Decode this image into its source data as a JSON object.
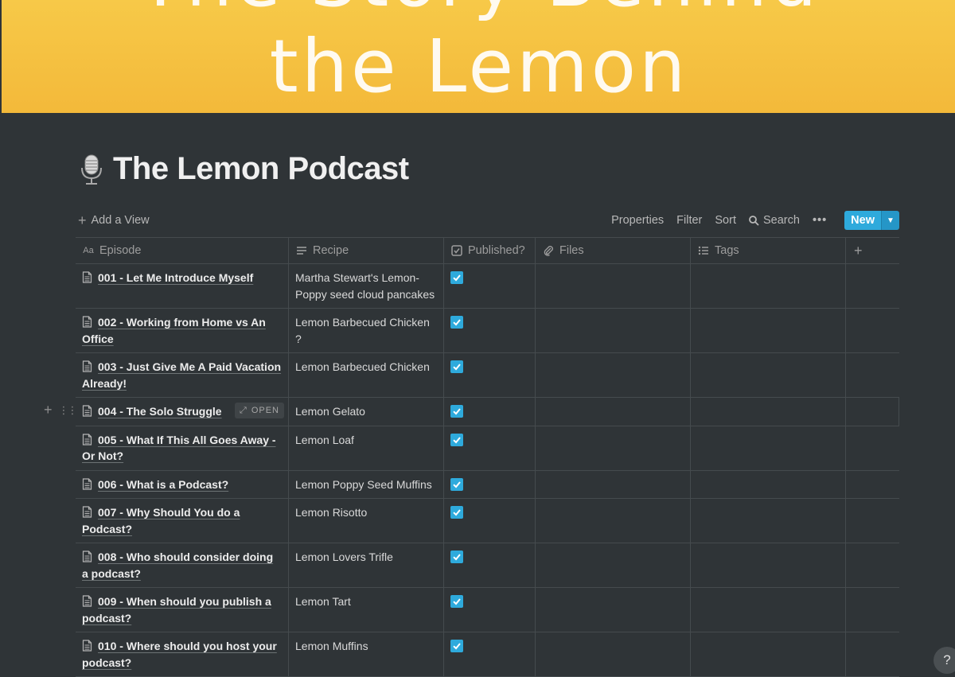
{
  "cover": {
    "title_line1": "The Story Behind",
    "title_line2": "the Lemon"
  },
  "page": {
    "icon": "microphone-icon",
    "title": "The Lemon Podcast"
  },
  "toolbar": {
    "add_view": "Add a View",
    "properties": "Properties",
    "filter": "Filter",
    "sort": "Sort",
    "search": "Search",
    "new": "New"
  },
  "table": {
    "columns": [
      {
        "label": "Episode",
        "icon": "title-icon"
      },
      {
        "label": "Recipe",
        "icon": "text-icon"
      },
      {
        "label": "Published?",
        "icon": "checkbox-icon"
      },
      {
        "label": "Files",
        "icon": "paperclip-icon"
      },
      {
        "label": "Tags",
        "icon": "list-icon"
      }
    ],
    "open_label": "OPEN",
    "rows": [
      {
        "episode": "001 - Let Me Introduce Myself",
        "recipe": "Martha Stewart's Lemon-Poppy seed cloud pancakes",
        "published": true
      },
      {
        "episode": "002 - Working from Home vs An Office",
        "recipe": " Lemon Barbecued Chicken ?",
        "published": true
      },
      {
        "episode": "003 - Just Give Me A Paid Vacation Already!",
        "recipe": "Lemon Barbecued Chicken",
        "published": true
      },
      {
        "episode": "004 - The Solo Struggle",
        "recipe": "Lemon Gelato",
        "published": true
      },
      {
        "episode": "005 - What If This All Goes Away - Or Not?",
        "recipe": "Lemon Loaf",
        "published": true
      },
      {
        "episode": "006 - What is a Podcast?",
        "recipe": "Lemon Poppy Seed Muffins",
        "published": true
      },
      {
        "episode": "007 - Why Should You do a Podcast?",
        "recipe": "Lemon Risotto",
        "published": true
      },
      {
        "episode": "008 - Who should consider doing a podcast?",
        "recipe": "Lemon Lovers Trifle",
        "published": true
      },
      {
        "episode": "009 - When should you publish a podcast?",
        "recipe": "Lemon Tart",
        "published": true
      },
      {
        "episode": "010 - Where should you host your podcast?",
        "recipe": "Lemon Muffins",
        "published": true
      }
    ]
  },
  "help": "?"
}
